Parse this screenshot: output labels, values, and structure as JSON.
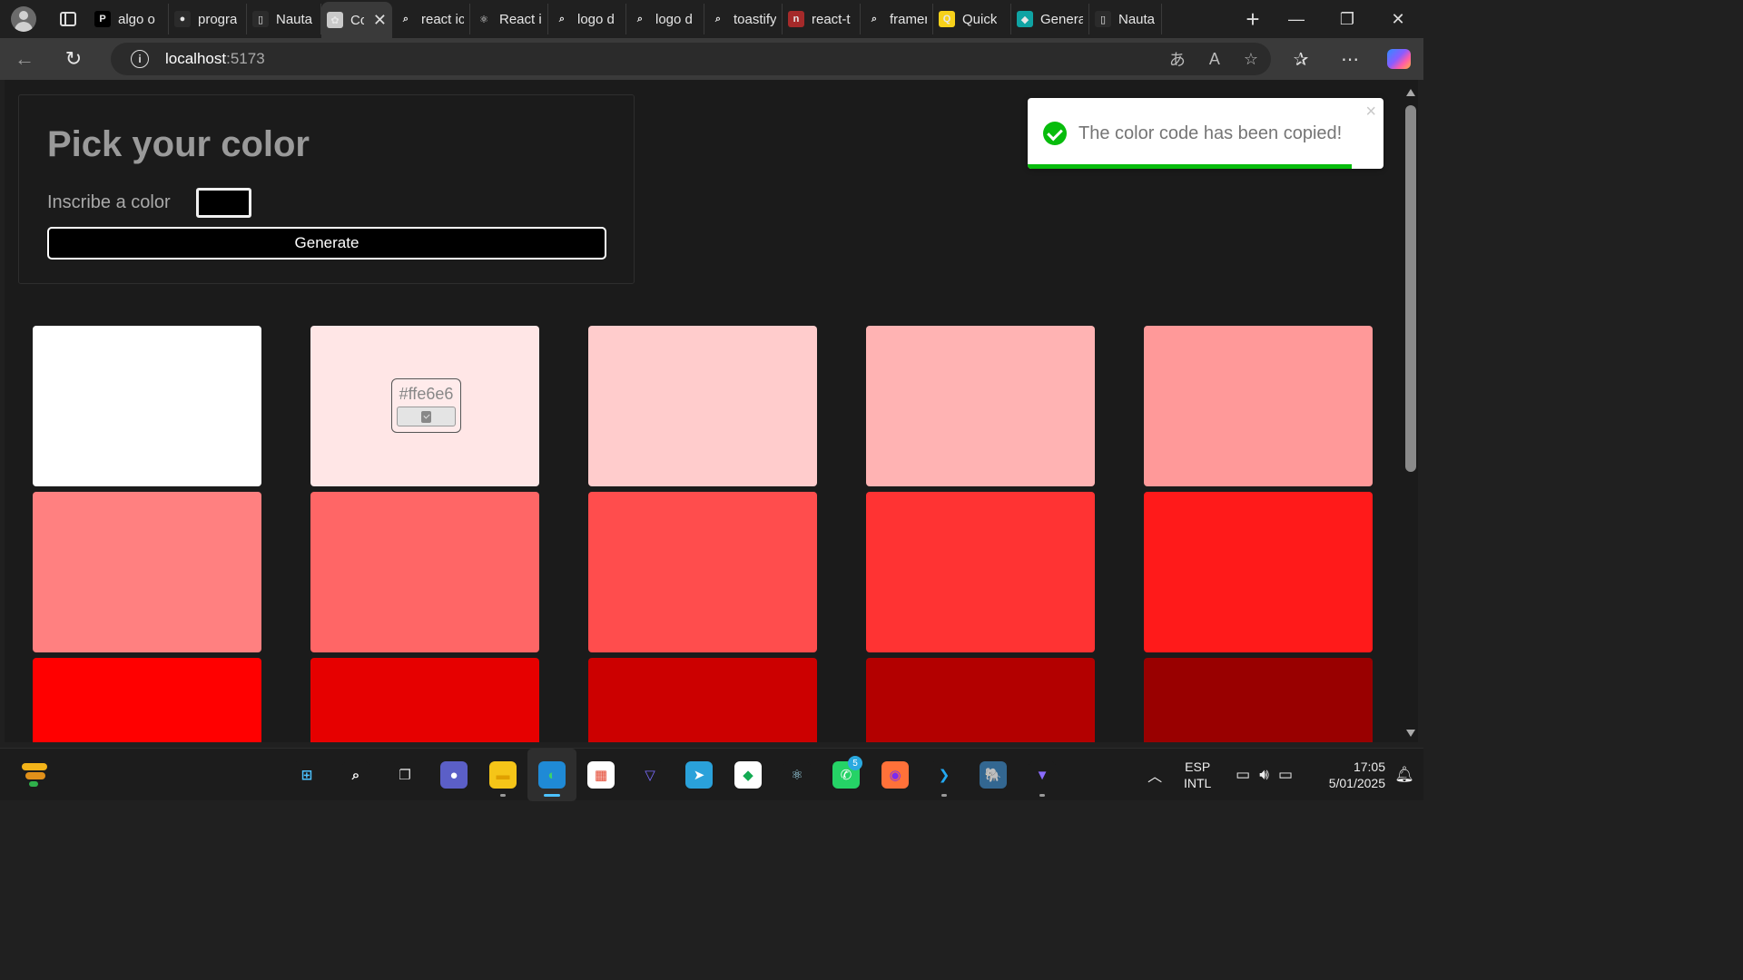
{
  "browser": {
    "tabs": [
      {
        "label": "algo o",
        "fav": "P",
        "fav_bg": "#000000",
        "active": false
      },
      {
        "label": "progra",
        "fav": "●",
        "fav_bg": "#2b2b2b",
        "active": false
      },
      {
        "label": "Nauta",
        "fav": "▯",
        "fav_bg": "#2b2b2b",
        "active": false
      },
      {
        "label": "Cc",
        "fav": "✿",
        "fav_bg": "#c9c9c9",
        "active": true
      },
      {
        "label": "react ic",
        "fav": "⌕",
        "fav_bg": "#202020",
        "active": false
      },
      {
        "label": "React i",
        "fav": "⚛",
        "fav_bg": "#202020",
        "active": false
      },
      {
        "label": "logo d",
        "fav": "⌕",
        "fav_bg": "#202020",
        "active": false
      },
      {
        "label": "logo d",
        "fav": "⌕",
        "fav_bg": "#202020",
        "active": false
      },
      {
        "label": "toastify",
        "fav": "⌕",
        "fav_bg": "#202020",
        "active": false
      },
      {
        "label": "react-t",
        "fav": "n",
        "fav_bg": "#a52a2a",
        "active": false
      },
      {
        "label": "framer",
        "fav": "⌕",
        "fav_bg": "#202020",
        "active": false
      },
      {
        "label": "Quick",
        "fav": "Q",
        "fav_bg": "#f7d11a",
        "active": false
      },
      {
        "label": "Genera",
        "fav": "◆",
        "fav_bg": "#0fa3a3",
        "active": false
      },
      {
        "label": "Nauta",
        "fav": "▯",
        "fav_bg": "#2b2b2b",
        "active": false
      }
    ],
    "url_host": "localhost",
    "url_port": ":5173"
  },
  "page": {
    "title": "Pick your color",
    "input_label": "Inscribe a color",
    "input_color": "#000000",
    "generate_label": "Generate"
  },
  "toast": {
    "message": "The color code has been copied!",
    "close": "×",
    "progress": 0.91
  },
  "swatches": [
    {
      "color": "#ffffff"
    },
    {
      "color": "#ffe6e6",
      "hover_code": "#ffe6e6"
    },
    {
      "color": "#ffcccc"
    },
    {
      "color": "#ffb3b3"
    },
    {
      "color": "#ff9999"
    },
    {
      "color": "#ff8080"
    },
    {
      "color": "#ff6666"
    },
    {
      "color": "#ff4d4d"
    },
    {
      "color": "#ff3333"
    },
    {
      "color": "#ff1a1a"
    },
    {
      "color": "#ff0000"
    },
    {
      "color": "#e60000"
    },
    {
      "color": "#cc0000"
    },
    {
      "color": "#b30000"
    },
    {
      "color": "#990000"
    }
  ],
  "taskbar": {
    "apps": [
      {
        "name": "start",
        "glyph": "⊞",
        "bg": "#1c1c1c",
        "fg": "#4cc2ff"
      },
      {
        "name": "search",
        "glyph": "⌕",
        "bg": "#1c1c1c",
        "fg": "#ffffff"
      },
      {
        "name": "task-view",
        "glyph": "❐",
        "bg": "#1c1c1c",
        "fg": "#dddddd"
      },
      {
        "name": "chat",
        "glyph": "●",
        "bg": "#5b5fc7",
        "fg": "#ffffff"
      },
      {
        "name": "file-explorer",
        "glyph": "▬",
        "bg": "#f5c518",
        "fg": "#e0a000",
        "running": true
      },
      {
        "name": "edge",
        "glyph": "◐",
        "bg": "#1f8ad6",
        "fg": "#3cd36a",
        "running": true,
        "active": true
      },
      {
        "name": "store",
        "glyph": "▦",
        "bg": "#ffffff",
        "fg": "#e3412b"
      },
      {
        "name": "proton-vpn",
        "glyph": "▽",
        "bg": "#1c1c1c",
        "fg": "#7a6cff"
      },
      {
        "name": "telegram",
        "glyph": "➤",
        "bg": "#2aa1da",
        "fg": "#ffffff"
      },
      {
        "name": "mongodb-compass",
        "glyph": "◆",
        "bg": "#ffffff",
        "fg": "#13aa52"
      },
      {
        "name": "electron-app",
        "glyph": "⚛",
        "bg": "#1c1c1c",
        "fg": "#9fd7ea"
      },
      {
        "name": "whatsapp",
        "glyph": "✆",
        "bg": "#25d366",
        "fg": "#ffffff",
        "badge": "5"
      },
      {
        "name": "firefox",
        "glyph": "◉",
        "bg": "#ff7139",
        "fg": "#7b2cf0"
      },
      {
        "name": "vscode",
        "glyph": "❯",
        "bg": "#1c1c1c",
        "fg": "#23a9f2",
        "running": true
      },
      {
        "name": "postgresql",
        "glyph": "🐘",
        "bg": "#336791",
        "fg": "#ffffff"
      },
      {
        "name": "vite-tool",
        "glyph": "▼",
        "bg": "#1c1c1c",
        "fg": "#8b6cff",
        "running": true
      }
    ],
    "lang_top": "ESP",
    "lang_bottom": "INTL",
    "time": "17:05",
    "date": "5/01/2025"
  }
}
